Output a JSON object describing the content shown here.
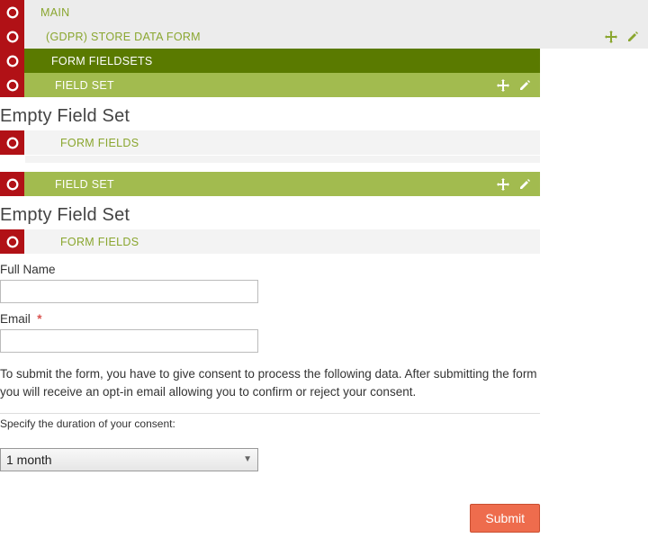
{
  "tree": {
    "main": "MAIN",
    "gdpr": "(GDPR) STORE DATA FORM",
    "formFieldsets": "FORM FIELDSETS",
    "fieldSet1": "FIELD SET",
    "fieldSet2": "FIELD SET",
    "formFields1": "FORM FIELDS",
    "formFields2": "FORM FIELDS"
  },
  "headings": {
    "empty1": "Empty Field Set",
    "empty2": "Empty Field Set"
  },
  "form": {
    "fullName": {
      "label": "Full Name",
      "value": ""
    },
    "email": {
      "label": "Email",
      "value": "",
      "required": "*"
    },
    "consentText": "To submit the form, you have to give consent to process the following data. After submitting the form you will receive an opt-in email allowing you to confirm or reject your consent.",
    "durationLabel": "Specify the duration of your consent:",
    "durationValue": "1 month",
    "submit": "Submit"
  }
}
